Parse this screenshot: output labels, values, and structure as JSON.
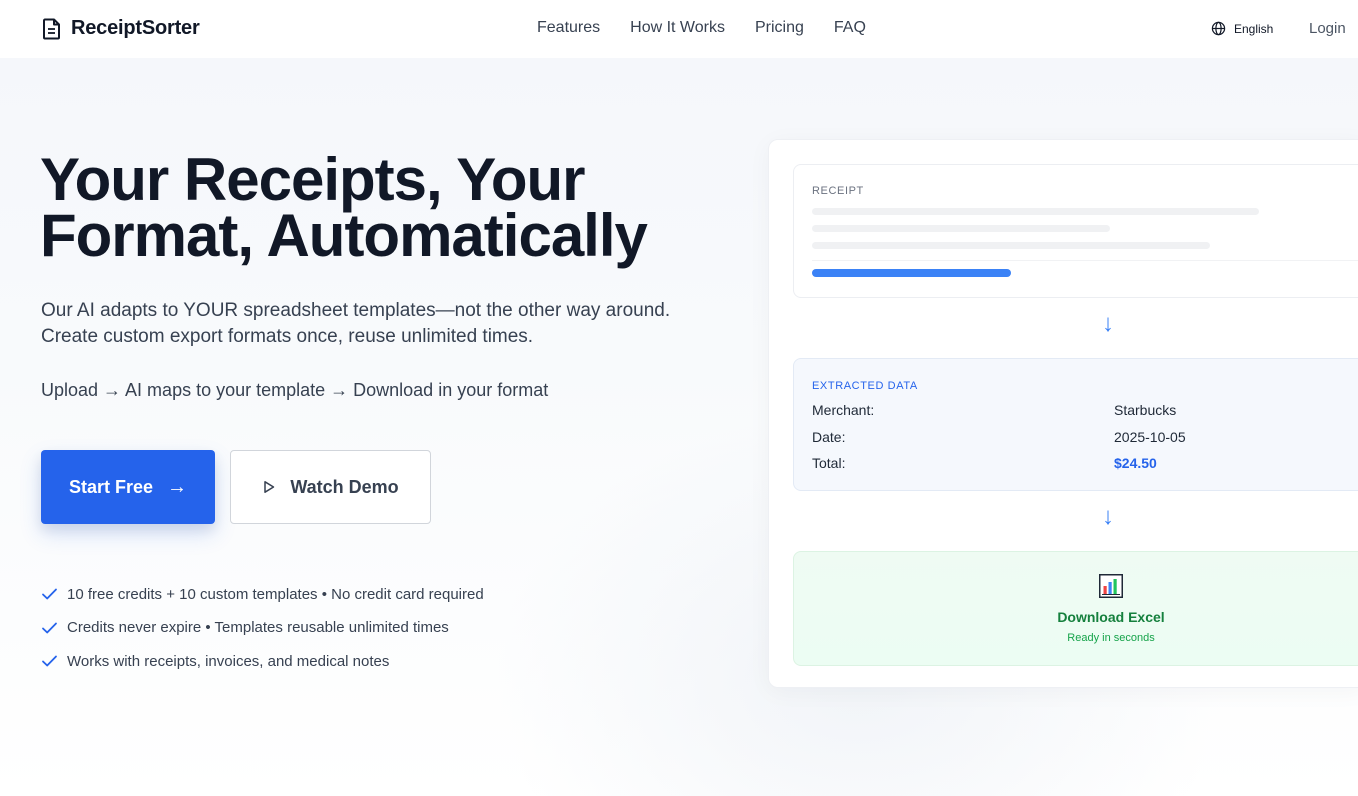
{
  "nav": {
    "brand": "ReceiptSorter",
    "links": [
      "Features",
      "How It Works",
      "Pricing",
      "FAQ"
    ],
    "language": "English",
    "login": "Login"
  },
  "hero": {
    "title_line1": "Your Receipts, Your",
    "title_line2": "Format, Automatically",
    "subtitle_line1": "Our AI adapts to YOUR spreadsheet templates—not the other way around.",
    "subtitle_line2": "Create custom export formats once, reuse unlimited times.",
    "flow": "Upload → AI maps to your template → Download in your format",
    "cta_primary": "Start Free",
    "cta_primary_arrow": "→",
    "cta_secondary": "Watch Demo",
    "checks": [
      "10 free credits + 10 custom templates • No credit card required",
      "Credits never expire • Templates reusable unlimited times",
      "Works with receipts, invoices, and medical notes"
    ]
  },
  "preview": {
    "receipt_label": "RECEIPT",
    "arrow": "↓",
    "extracted_label": "EXTRACTED DATA",
    "rows": [
      {
        "key": "Merchant:",
        "value": "Starbucks"
      },
      {
        "key": "Date:",
        "value": "2025-10-05"
      },
      {
        "key": "Total:",
        "value": "$24.50"
      }
    ],
    "download_title": "Download Excel",
    "download_sub": "Ready in seconds"
  },
  "colors": {
    "accent": "#2563eb",
    "success": "#15803d"
  }
}
